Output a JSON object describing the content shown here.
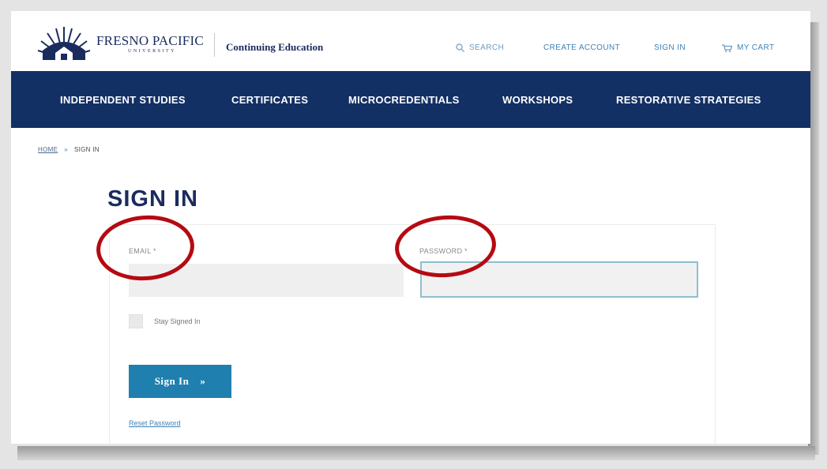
{
  "brand": {
    "name": "FRESNO PACIFIC",
    "sub": "UNIVERSITY",
    "section": "Continuing Education"
  },
  "utility_nav": {
    "search": "SEARCH",
    "create_account": "CREATE ACCOUNT",
    "sign_in": "SIGN IN",
    "cart": "MY CART"
  },
  "main_nav": {
    "items": [
      {
        "label": "INDEPENDENT STUDIES"
      },
      {
        "label": "CERTIFICATES"
      },
      {
        "label": "MICROCREDENTIALS"
      },
      {
        "label": "WORKSHOPS"
      },
      {
        "label": "RESTORATIVE STRATEGIES"
      }
    ]
  },
  "breadcrumb": {
    "home": "HOME",
    "separator": "»",
    "current": "SIGN IN"
  },
  "page": {
    "title": "SIGN IN"
  },
  "form": {
    "email_label": "EMAIL *",
    "email_value": "",
    "password_label": "PASSWORD *",
    "password_value": "",
    "remember_label": "Stay Signed In",
    "submit_label": "Sign In",
    "submit_arrow": "»",
    "reset_label": "Reset Password"
  },
  "colors": {
    "nav_bg": "#133065",
    "brand_navy": "#1a2c5e",
    "link_blue": "#3d83b8",
    "button_blue": "#1f7fae",
    "annotation_red": "#b50a12"
  }
}
